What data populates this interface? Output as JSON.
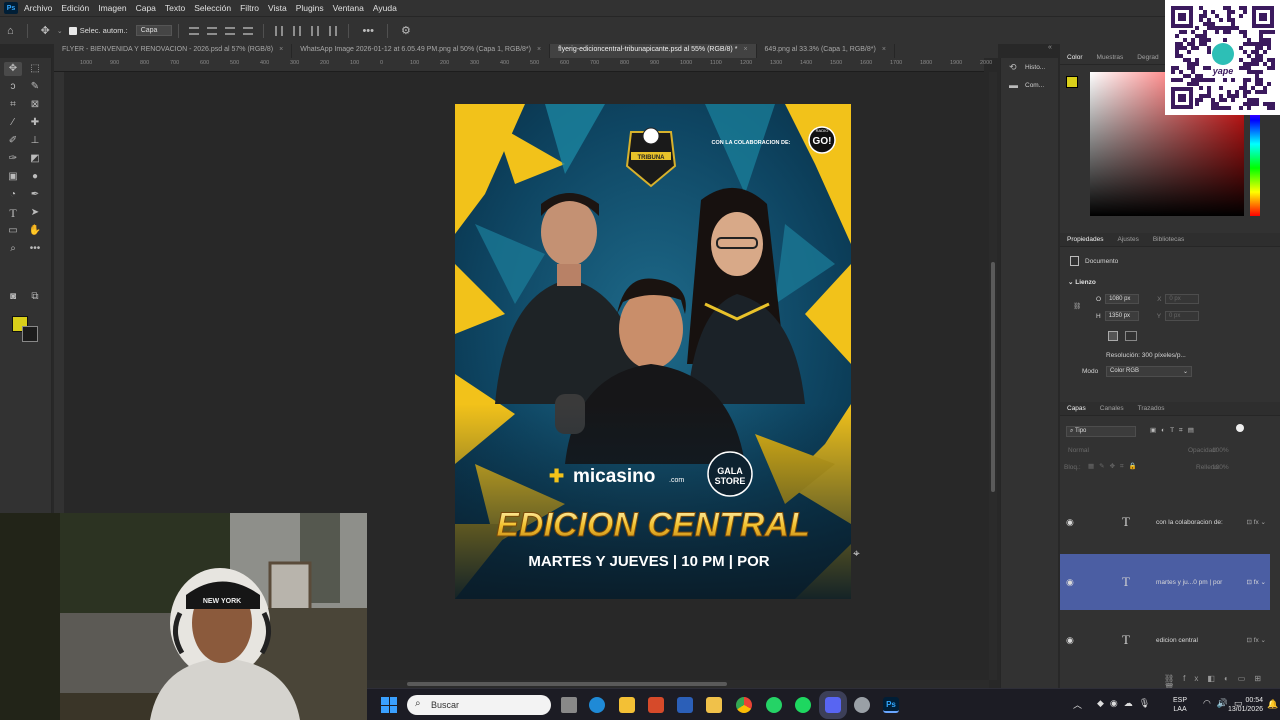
{
  "menubar": {
    "items": [
      "Archivo",
      "Edición",
      "Imagen",
      "Capa",
      "Texto",
      "Selección",
      "Filtro",
      "Vista",
      "Plugins",
      "Ventana",
      "Ayuda"
    ]
  },
  "options_bar": {
    "auto_select_label": "Selec. autom.:",
    "target_value": "Capa"
  },
  "tabs": [
    "FLYER - BIENVENIDA Y RENOVACION - 2026.psd al 57% (RGB/8)",
    "WhatsApp Image 2026-01-12 at 6.05.49 PM.png al 50% (Capa 1, RGB/8*)",
    "flyerig-edicioncentral-tribunapicante.psd al 55% (RGB/8) *",
    "649.png al 33.3% (Capa 1, RGB/8*)"
  ],
  "ruler_labels": [
    "1000",
    "900",
    "800",
    "700",
    "600",
    "500",
    "400",
    "300",
    "200",
    "100",
    "0",
    "100",
    "200",
    "300",
    "400",
    "500",
    "600",
    "700",
    "800",
    "900",
    "1000",
    "1100",
    "1200",
    "1300",
    "1400",
    "1500",
    "1600",
    "1700",
    "1800",
    "1900",
    "2000"
  ],
  "flyer": {
    "collab_text": "CON LA COLABORACION DE:",
    "radio_label": "RADIO",
    "radio_name": "GO!",
    "club_name": "TRIBUNA",
    "sponsor1": "micasino",
    "sponsor1_suffix": ".com",
    "sponsor2_line1": "GALA",
    "sponsor2_line2": "STORE",
    "headline": "EDICION CENTRAL",
    "schedule": "MARTES Y JUEVES | 10 PM | POR"
  },
  "dock": {
    "history_label": "Histo...",
    "comments_label": "Com..."
  },
  "color_panel": {
    "tabs": [
      "Color",
      "Muestras",
      "Degrad"
    ],
    "foreground": "#d9cf1a"
  },
  "properties": {
    "tabs": [
      "Propiedades",
      "Ajustes",
      "Bibliotecas"
    ],
    "type_label": "Documento",
    "section": "Lienzo",
    "width_label": "O",
    "width_value": "1080 px",
    "height_label": "H",
    "height_value": "1350 px",
    "x_label": "X",
    "x_placeholder": "0 px",
    "y_label": "Y",
    "y_placeholder": "0 px",
    "resolution": "Resolución: 300 píxeles/p...",
    "mode_label": "Modo",
    "mode_value": "Color RGB"
  },
  "layers_panel": {
    "tabs": [
      "Capas",
      "Canales",
      "Trazados"
    ],
    "filter_value": "Tipo",
    "blend_mode": "Normal",
    "opacity_label": "Opacidad:",
    "opacity_value": "100%",
    "lock_label": "Bloq.:",
    "fill_label": "Relleno:",
    "fill_value": "100%",
    "layers": [
      {
        "name": "con la colaboracion de:",
        "selected": false
      },
      {
        "name": "martes y ju...0 pm | por",
        "selected": true
      },
      {
        "name": "edicion central",
        "selected": false
      }
    ]
  },
  "taskbar": {
    "search_placeholder": "Buscar",
    "lang": "ESP",
    "region": "LAA",
    "time": "00:54",
    "date": "13/01/2026"
  },
  "qr": {
    "brand": "yape"
  }
}
